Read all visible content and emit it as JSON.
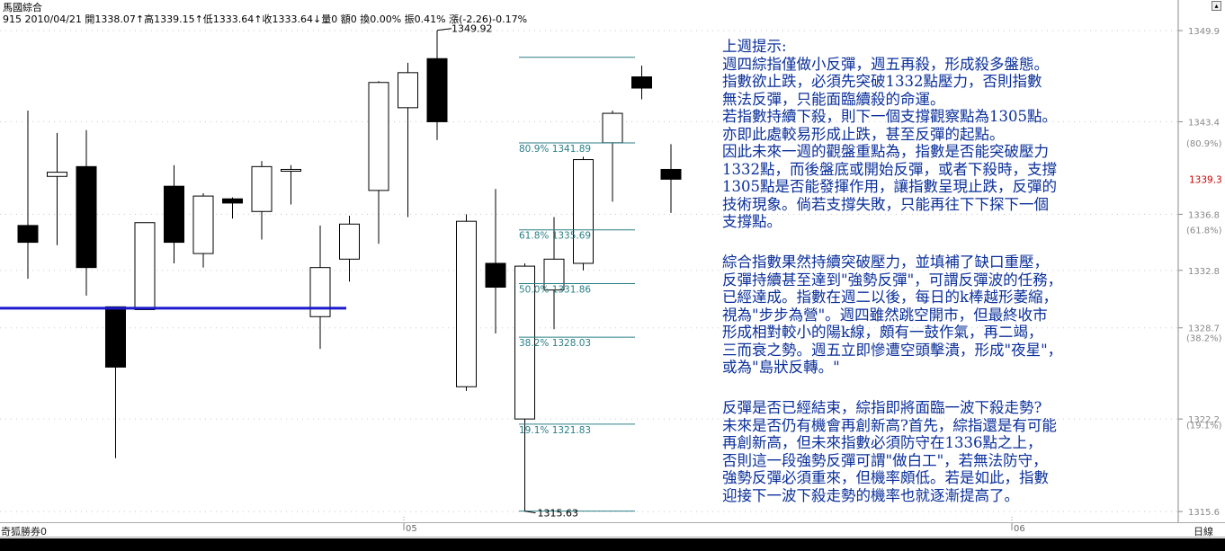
{
  "header": {
    "title": "馬國綜合",
    "quote": "915 2010/04/21 開1338.07↑高1339.15↑低1333.64↑收1333.64↓量0 額0 換0.00% 振0.41% 漲(-2.26)-0.17%"
  },
  "notes": {
    "p1": [
      "上週提示:",
      "週四綜指僅做小反彈，週五再殺，形成殺多盤態。",
      "指數欲止跌，必須先突破1332點壓力，否則指數",
      "無法反彈，只能面臨續殺的命運。",
      "若指數持續下殺，則下一個支撐觀察點為1305點。",
      "亦即此處較易形成止跌，甚至反彈的起點。",
      "因此未來一週的觀盤重點為，指數是否能突破壓力",
      "1332點，而後盤底或開始反彈，或者下殺時，支撐",
      "1305點是否能發揮作用，讓指數呈現止跌，反彈的",
      "技術現象。倘若支撐失敗，只能再往下下探下一個",
      "支撐點。"
    ],
    "p2": [
      "綜合指數果然持續突破壓力，並填補了缺口重壓，",
      "反彈持續甚至達到\"強勢反彈\"，可謂反彈波的任務，",
      "已經達成。指數在週二以後，每日的k棒越形萎縮，",
      "視為\"步步為營\"。週四雖然跳空開市，但最終收市",
      "形成相對較小的陽k線，頗有一鼓作氣，再二竭，",
      "三而衰之勢。週五立即慘遭空頭擊潰，形成\"夜星\"，",
      "或為\"島狀反轉。\""
    ],
    "p3": [
      "反彈是否已經結束，綜指即將面臨一波下殺走勢?",
      "未來是否仍有機會再創新高?首先，綜指還是有可能",
      "再創新高，但未來指數必須防守在1336點之上，",
      "否則這一段強勢反彈可謂\"做白工\"，若無法防守，",
      "強勢反彈必須重來，但機率頗低。若是如此，指數",
      "迎接下一波下殺走勢的機率也就逐漸提高了。"
    ]
  },
  "footer": {
    "left_label": "奇狐勝券0",
    "period": "日線"
  },
  "chart_data": {
    "type": "candlestick",
    "ylim": [
      1314.9,
      1350.8
    ],
    "y_ticks": [
      "1349.9",
      "1343.4",
      "1336.8",
      "1332.8",
      "1328.7",
      "1322.2",
      "1315.6"
    ],
    "y_tick_values": [
      1349.9,
      1343.4,
      1336.8,
      1332.8,
      1328.7,
      1322.2,
      1315.6
    ],
    "fib_axis_labels": [
      "(80.9%)",
      "(61.8%)",
      "(38.2%)",
      "(19.1%)"
    ],
    "fib_axis_values": [
      1341.9,
      1335.7,
      1328.0,
      1321.8
    ],
    "current_price": "1339.3",
    "x_labels": [
      "05",
      "06"
    ],
    "candles": [
      {
        "o": 1336.0,
        "h": 1344.2,
        "l": 1332.2,
        "c": 1334.8
      },
      {
        "o": 1339.5,
        "h": 1342.6,
        "l": 1334.6,
        "c": 1339.8
      },
      {
        "o": 1340.2,
        "h": 1342.8,
        "l": 1331.0,
        "c": 1333.0
      },
      {
        "o": 1330.2,
        "h": 1330.2,
        "l": 1319.4,
        "c": 1325.9
      },
      {
        "o": 1330.0,
        "h": 1336.2,
        "l": 1330.0,
        "c": 1336.2
      },
      {
        "o": 1338.8,
        "h": 1340.3,
        "l": 1333.3,
        "c": 1334.8
      },
      {
        "o": 1334.0,
        "h": 1338.3,
        "l": 1333.0,
        "c": 1338.1
      },
      {
        "o": 1337.9,
        "h": 1338.0,
        "l": 1336.5,
        "c": 1337.6
      },
      {
        "o": 1337.0,
        "h": 1340.6,
        "l": 1335.0,
        "c": 1340.2
      },
      {
        "o": 1340.0,
        "h": 1340.3,
        "l": 1337.5,
        "c": 1340.0
      },
      {
        "o": 1329.5,
        "h": 1336.0,
        "l": 1327.2,
        "c": 1333.0
      },
      {
        "o": 1333.6,
        "h": 1336.7,
        "l": 1332.0,
        "c": 1336.1
      },
      {
        "o": 1338.5,
        "h": 1346.3,
        "l": 1334.7,
        "c": 1346.2
      },
      {
        "o": 1344.4,
        "h": 1347.6,
        "l": 1336.6,
        "c": 1346.9
      },
      {
        "o": 1347.9,
        "h": 1349.9,
        "l": 1342.1,
        "c": 1343.4
      },
      {
        "o": 1324.5,
        "h": 1336.8,
        "l": 1324.2,
        "c": 1336.3
      },
      {
        "o": 1333.3,
        "h": 1338.6,
        "l": 1328.3,
        "c": 1331.6
      },
      {
        "o": 1322.2,
        "h": 1333.3,
        "l": 1315.6,
        "c": 1333.1
      },
      {
        "o": 1331.4,
        "h": 1336.6,
        "l": 1328.6,
        "c": 1333.6
      },
      {
        "o": 1333.3,
        "h": 1340.9,
        "l": 1332.8,
        "c": 1340.7
      },
      {
        "o": 1341.9,
        "h": 1344.2,
        "l": 1337.7,
        "c": 1344.0
      },
      {
        "o": 1346.6,
        "h": 1347.4,
        "l": 1345.0,
        "c": 1345.8
      },
      {
        "o": 1340.0,
        "h": 1341.8,
        "l": 1336.9,
        "c": 1339.3
      }
    ],
    "support_line": {
      "value": 1330.1
    },
    "fibonacci": [
      {
        "label": "80.9% 1341.89",
        "value": 1341.89
      },
      {
        "label": "61.8% 1335.69",
        "value": 1335.69
      },
      {
        "label": "50.0% 1331.86",
        "value": 1331.86
      },
      {
        "label": "38.2% 1328.03",
        "value": 1328.03
      },
      {
        "label": "19.1% 1321.83",
        "value": 1321.83
      }
    ],
    "high_mark": {
      "label": "1349.92",
      "value": 1349.92
    },
    "low_mark": {
      "label": "1315.63",
      "value": 1315.63
    }
  }
}
